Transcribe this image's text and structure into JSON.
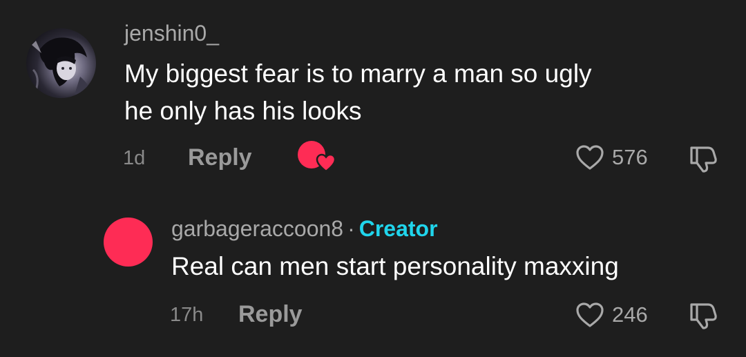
{
  "comments": [
    {
      "username": "jenshin0_",
      "text_line1": "My biggest fear is to marry a man so ugly",
      "text_line2": "he only has his looks",
      "time": "1d",
      "reply_label": "Reply",
      "likes": "576",
      "creator_liked": true
    },
    {
      "username": "garbageraccoon8",
      "separator": "·",
      "badge": "Creator",
      "text_line1": "Real can men start personality maxxing",
      "time": "17h",
      "reply_label": "Reply",
      "likes": "246",
      "avatar_color": "#fe2c55"
    }
  ],
  "colors": {
    "background": "#1e1e1e",
    "accent_pink": "#fe2c55",
    "creator_cyan": "#20d5ec"
  },
  "icons": {
    "like": "heart-outline-icon",
    "dislike": "thumbs-down-outline-icon",
    "creator_liked": "creator-liked-heart-icon"
  }
}
